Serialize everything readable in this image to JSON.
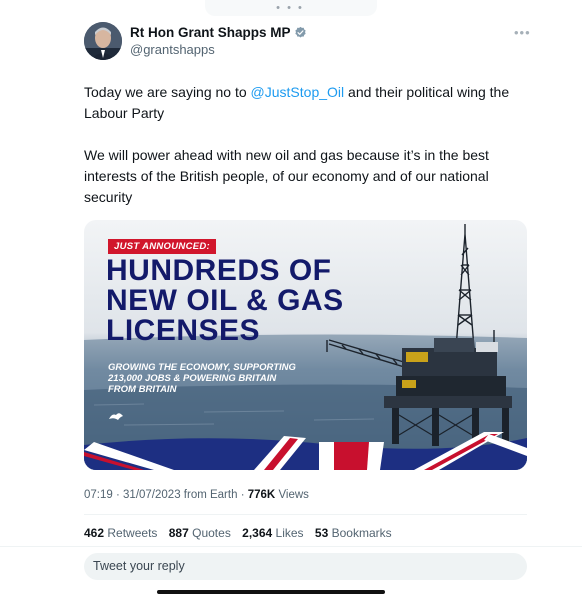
{
  "author": {
    "name": "Rt Hon Grant Shapps MP",
    "handle": "@grantshapps"
  },
  "tweet": {
    "text_before_mention": "Today we are saying no to ",
    "mention": "@JustStop_Oil",
    "text_after_mention": " and their political wing the Labour Party",
    "paragraph_2": "We will power ahead with new oil and gas because it’s in the best interests of the British people, of our economy and of our national security"
  },
  "media": {
    "tag": "JUST ANNOUNCED:",
    "headline": [
      "HUNDREDS OF",
      "NEW OIL & GAS",
      "LICENSES"
    ],
    "subheadline": [
      "GROWING THE ECONOMY, SUPPORTING",
      "213,000 JOBS & POWERING BRITAIN",
      "FROM BRITAIN"
    ],
    "colors": {
      "navy": "#131a6a",
      "red": "#d1162c"
    }
  },
  "meta": {
    "time": "07:19",
    "separator": "·",
    "date": "31/07/2023",
    "source": "from Earth",
    "views_count": "776K",
    "views_label": "Views"
  },
  "stats": {
    "retweets_count": "462",
    "retweets_label": "Retweets",
    "quotes_count": "887",
    "quotes_label": "Quotes",
    "likes_count": "2,364",
    "likes_label": "Likes",
    "bookmarks_count": "53",
    "bookmarks_label": "Bookmarks"
  },
  "reply": {
    "placeholder": "Tweet your reply"
  },
  "icons": {
    "verified": "verified-badge-icon",
    "more": "more-options-icon"
  },
  "colors": {
    "link": "#1d9bf0",
    "secondary_text": "#536471"
  }
}
